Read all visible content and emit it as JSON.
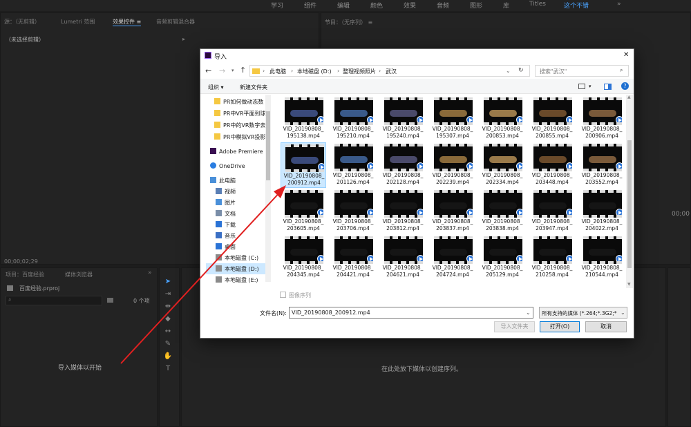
{
  "workspaces": [
    "学习",
    "组件",
    "编辑",
    "颜色",
    "效果",
    "音频",
    "图形",
    "库",
    "Titles",
    "这个不错"
  ],
  "workspaces_more": "»",
  "source_panel": {
    "tabs": [
      "源：（无剪辑）",
      "Lumetri 范围",
      "效果控件 ≡",
      "音频剪辑混合器"
    ],
    "no_clip": "（未选择剪辑）",
    "timecode": "00;00;02;29"
  },
  "program_panel": {
    "tab": "节目：（无序列） ≡",
    "timecode": "00;00"
  },
  "project_panel": {
    "tabs": [
      "项目：百度经验",
      "媒体浏览器"
    ],
    "file": "百度经验.prproj",
    "item_count": "0 个项",
    "empty_hint": "导入媒体以开始"
  },
  "timeline_panel": {
    "empty_hint": "在此处放下媒体以创建序列。"
  },
  "dialog": {
    "title": "导入",
    "close": "✕",
    "breadcrumb": [
      "此电脑",
      "本地磁盘 (D:)",
      "整理视频照片",
      "武汉"
    ],
    "search_placeholder": "搜索\"武汉\"",
    "organize": "组织 ▾",
    "new_folder": "新建文件夹",
    "help": "?",
    "nav": [
      {
        "label": "PR如何做动态数",
        "icon": "folder"
      },
      {
        "label": "PR中VR平面到球",
        "icon": "folder"
      },
      {
        "label": "PR中的VR数字去",
        "icon": "folder"
      },
      {
        "label": "PR中模拟VR投影",
        "icon": "folder"
      },
      {
        "label": "Adobe Premiere",
        "icon": "premiere"
      },
      {
        "label": "OneDrive",
        "icon": "cloud"
      },
      {
        "label": "此电脑",
        "icon": "pc"
      },
      {
        "label": "视频",
        "icon": "video"
      },
      {
        "label": "图片",
        "icon": "image"
      },
      {
        "label": "文档",
        "icon": "doc"
      },
      {
        "label": "下载",
        "icon": "download"
      },
      {
        "label": "音乐",
        "icon": "music"
      },
      {
        "label": "桌面",
        "icon": "desktop"
      },
      {
        "label": "本地磁盘 (C:)",
        "icon": "drive"
      },
      {
        "label": "本地磁盘 (D:)",
        "icon": "drive",
        "selected": true
      },
      {
        "label": "本地磁盘 (E:)",
        "icon": "drive"
      }
    ],
    "files": [
      "VID_20190808_\n195138.mp4",
      "VID_20190808_\n195210.mp4",
      "VID_20190808_\n195240.mp4",
      "VID_20190808_\n195307.mp4",
      "VID_20190808_\n200853.mp4",
      "VID_20190808_\n200855.mp4",
      "VID_20190808_\n200906.mp4",
      "VID_20190808_\n200912.mp4",
      "VID_20190808_\n201126.mp4",
      "VID_20190808_\n202128.mp4",
      "VID_20190808_\n202239.mp4",
      "VID_20190808_\n202334.mp4",
      "VID_20190808_\n203448.mp4",
      "VID_20190808_\n203552.mp4",
      "VID_20190808_\n203605.mp4",
      "VID_20190808_\n203706.mp4",
      "VID_20190808_\n203812.mp4",
      "VID_20190808_\n203837.mp4",
      "VID_20190808_\n203838.mp4",
      "VID_20190808_\n203947.mp4",
      "VID_20190808_\n204022.mp4",
      "VID_20190808_\n204345.mp4",
      "VID_20190808_\n204421.mp4",
      "VID_20190808_\n204621.mp4",
      "VID_20190808_\n204724.mp4",
      "VID_20190808_\n205129.mp4",
      "VID_20190808_\n210258.mp4",
      "VID_20190808_\n210544.mp4"
    ],
    "selected_file_index": 7,
    "image_sequence": "图像序列",
    "filename_label": "文件名(N):",
    "filename_value": "VID_20190808_200912.mp4",
    "filter": "所有支持的媒体 (*.264;*.3G2;*",
    "import_folder": "导入文件夹",
    "open": "打开(O)",
    "cancel": "取消"
  },
  "colors": {
    "accent": "#4aa3ff",
    "annotation_arrow": "#e02020",
    "selection": "#cce8ff"
  }
}
